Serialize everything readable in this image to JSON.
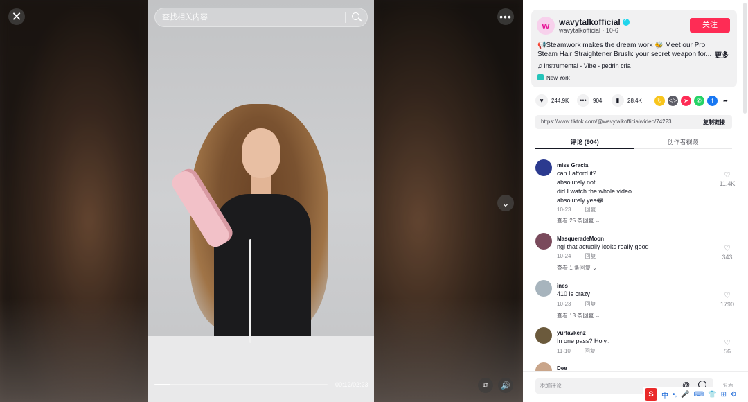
{
  "search": {
    "placeholder": "查找相关内容"
  },
  "player": {
    "time": "00:12/02:23",
    "progress_fraction": 0.09,
    "close_glyph": "✕",
    "more_glyph": "•••",
    "down_glyph": "⌄",
    "pip_glyph": "⧉",
    "volume_glyph": "🔊"
  },
  "post": {
    "avatar_letter": "w",
    "username": "wavytalkofficial",
    "subline": "wavytalkofficial · 10-6",
    "follow_label": "关注",
    "description": "📢Steamwork makes the dream work 🐝 Meet our Pro Steam Hair Straightener Brush: your secret weapon for...",
    "more_label": "更多",
    "music": "♫  Instrumental - Vibe - pedrin cria",
    "location": "New York"
  },
  "stats": {
    "likes": "244.9K",
    "comments": "904",
    "saves": "28.4K"
  },
  "share_colors": [
    "#f8c51c",
    "#5c5c66",
    "#fe2c55",
    "#25d366",
    "#1877f2"
  ],
  "link": {
    "url": "https://www.tiktok.com/@wavytalkofficial/video/74223...",
    "copy_label": "复制链接"
  },
  "tabs": [
    {
      "label": "评论 (904)"
    },
    {
      "label": "创作者视频"
    }
  ],
  "comments": [
    {
      "name": "miss Gracia",
      "lines": "can I afford it?\nabsolutely not\ndid I watch the whole video\nabsolutely yes😂",
      "date": "10-23",
      "reply": "回复",
      "more": "查看 25 条回复 ⌄",
      "likes": "11.4K",
      "avatar_color": "#2b3a8f"
    },
    {
      "name": "MasqueradeMoon",
      "lines": "ngl that actually looks really good",
      "date": "10-24",
      "reply": "回复",
      "more": "查看 1 条回复 ⌄",
      "likes": "343",
      "avatar_color": "#7a4a5c"
    },
    {
      "name": "ines",
      "lines": "410 is crazy",
      "date": "10-23",
      "reply": "回复",
      "more": "查看 13 条回复 ⌄",
      "likes": "1790",
      "avatar_color": "#a7b4bd"
    },
    {
      "name": "yurfavkenz",
      "lines": "In one pass? Holy..",
      "date": "11-10",
      "reply": "回复",
      "more": "",
      "likes": "56",
      "avatar_color": "#6b5a3c"
    },
    {
      "name": "Dee",
      "lines": "",
      "date": "",
      "reply": "",
      "more": "",
      "likes": "",
      "avatar_color": "#c9a58a"
    }
  ],
  "composer": {
    "placeholder": "添加评论...",
    "post_label": "发布"
  },
  "ime": {
    "logo": "S",
    "items": [
      "中",
      "•,",
      "🎤",
      "⌨",
      "👕",
      "⊞",
      "⚙"
    ]
  }
}
